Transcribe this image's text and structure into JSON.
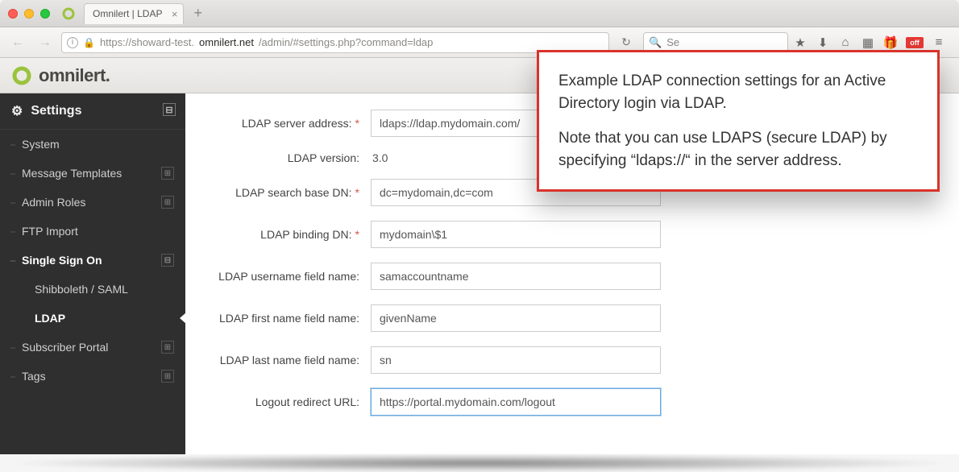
{
  "browser": {
    "tab_title": "Omnilert | LDAP",
    "url_prefix": "https://showard-test.",
    "url_domain": "omnilert.net",
    "url_path": "/admin/#settings.php?command=ldap",
    "search_placeholder": "Se",
    "ext_off_label": "off"
  },
  "brand": {
    "name": "omnilert",
    "stop": "."
  },
  "sidebar": {
    "header": "Settings",
    "items": [
      {
        "label": "System"
      },
      {
        "label": "Message Templates",
        "badge": "⊞"
      },
      {
        "label": "Admin Roles",
        "badge": "⊞"
      },
      {
        "label": "FTP Import"
      },
      {
        "label": "Single Sign On",
        "badge": "⊟",
        "open": true
      },
      {
        "label": "Shibboleth / SAML",
        "sub": true
      },
      {
        "label": "LDAP",
        "sub": true,
        "active": true
      },
      {
        "label": "Subscriber Portal",
        "badge": "⊞"
      },
      {
        "label": "Tags",
        "badge": "⊞"
      }
    ]
  },
  "form": {
    "rows": [
      {
        "label": "LDAP server address:",
        "required": true,
        "value": "ldaps://ldap.mydomain.com/"
      },
      {
        "label": "LDAP version:",
        "static": true,
        "value": "3.0"
      },
      {
        "label": "LDAP search base DN:",
        "required": true,
        "value": "dc=mydomain,dc=com"
      },
      {
        "label": "LDAP binding DN:",
        "required": true,
        "value": "mydomain\\$1"
      },
      {
        "label": "LDAP username field name:",
        "value": "samaccountname"
      },
      {
        "label": "LDAP first name field name:",
        "value": "givenName"
      },
      {
        "label": "LDAP last name field name:",
        "value": "sn"
      },
      {
        "label": "Logout redirect URL:",
        "value": "https://portal.mydomain.com/logout",
        "focused": true
      }
    ]
  },
  "callout": {
    "p1": "Example LDAP connection settings for an Active Directory login via LDAP.",
    "p2": "Note that you can use LDAPS (secure LDAP) by specifying “ldaps://“ in the server address."
  }
}
